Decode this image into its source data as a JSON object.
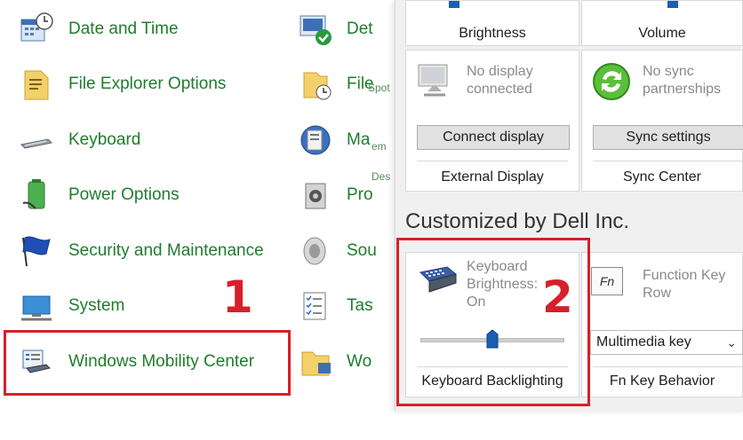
{
  "control_panel": {
    "items": [
      {
        "label": "Date and Time",
        "icon": "calendar-clock-icon"
      },
      {
        "label": "File Explorer Options",
        "icon": "folder-options-icon"
      },
      {
        "label": "Keyboard",
        "icon": "keyboard-icon"
      },
      {
        "label": "Power Options",
        "icon": "battery-plug-icon"
      },
      {
        "label": "Security and Maintenance",
        "icon": "flag-icon"
      },
      {
        "label": "System",
        "icon": "monitor-icon"
      },
      {
        "label": "Windows Mobility Center",
        "icon": "mobility-center-icon"
      }
    ],
    "column2": [
      {
        "label": "Det",
        "icon": "device-check-icon"
      },
      {
        "label": "File",
        "icon": "file-history-icon"
      },
      {
        "label": "Ma",
        "icon": "manage-icon"
      },
      {
        "label": "Pro",
        "icon": "programs-icon"
      },
      {
        "label": "Sou",
        "icon": "speaker-icon"
      },
      {
        "label": "Tas",
        "icon": "task-list-icon"
      },
      {
        "label": "Wo",
        "icon": "work-folders-icon"
      }
    ],
    "ghost_text": [
      "Spot",
      "em",
      "Des"
    ]
  },
  "annotations": {
    "one": "1",
    "two": "2",
    "color": "#d6202a"
  },
  "mobility_center": {
    "tiles": {
      "brightness": {
        "caption": "Brightness"
      },
      "volume": {
        "caption": "Volume"
      },
      "external_display": {
        "status": "No display connected",
        "status_line1": "No display",
        "status_line2": "connected",
        "button": "Connect display",
        "caption": "External Display"
      },
      "sync_center": {
        "status_line1": "No sync",
        "status_line2": "partnerships",
        "button": "Sync settings",
        "caption": "Sync Center"
      }
    },
    "customized_heading": "Customized by Dell Inc.",
    "keyboard_backlighting": {
      "status_line1": "Keyboard",
      "status_line2": "Brightness:",
      "status_line3": "On",
      "caption": "Keyboard Backlighting",
      "slider_level": 0.5
    },
    "fn_key": {
      "status_line1": "Function Key",
      "status_line2": "Row",
      "select_value": "Multimedia key",
      "caption": "Fn Key Behavior",
      "key_label": "Fn"
    }
  }
}
